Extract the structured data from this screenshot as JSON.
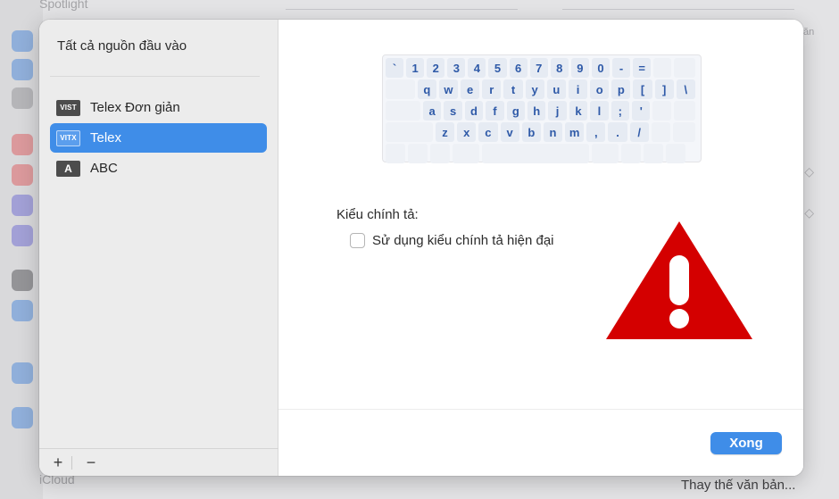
{
  "background": {
    "top_label": "Spotlight",
    "top_right_text": "ăn",
    "bottom_left_label": "iCloud",
    "bottom_right_button": "Thay thế văn bản..."
  },
  "sheet": {
    "title": "Tất cả nguồn đầu vào",
    "sources": [
      {
        "icon_text": "VIST",
        "label": "Telex Đơn giản",
        "selected": false
      },
      {
        "icon_text": "VITX",
        "label": "Telex",
        "selected": true
      },
      {
        "icon_text": "A",
        "label": "ABC",
        "selected": false
      }
    ],
    "footer": {
      "add": "+",
      "remove": "−"
    },
    "keyboard": {
      "row1": [
        "`",
        "1",
        "2",
        "3",
        "4",
        "5",
        "6",
        "7",
        "8",
        "9",
        "0",
        "-",
        "="
      ],
      "row2": [
        "q",
        "w",
        "e",
        "r",
        "t",
        "y",
        "u",
        "i",
        "o",
        "p",
        "[",
        "]",
        "\\"
      ],
      "row3": [
        "a",
        "s",
        "d",
        "f",
        "g",
        "h",
        "j",
        "k",
        "l",
        ";",
        "'"
      ],
      "row4": [
        "z",
        "x",
        "c",
        "v",
        "b",
        "n",
        "m",
        ",",
        ".",
        "/"
      ]
    },
    "spelling_title": "Kiểu chính tả:",
    "checkbox_label": "Sử dụng kiểu chính tả hiện đại",
    "checkbox_checked": false,
    "done_button": "Xong",
    "warning_icon": "warning-triangle",
    "accent_color": "#3f8de8",
    "warning_color": "#d40000"
  }
}
